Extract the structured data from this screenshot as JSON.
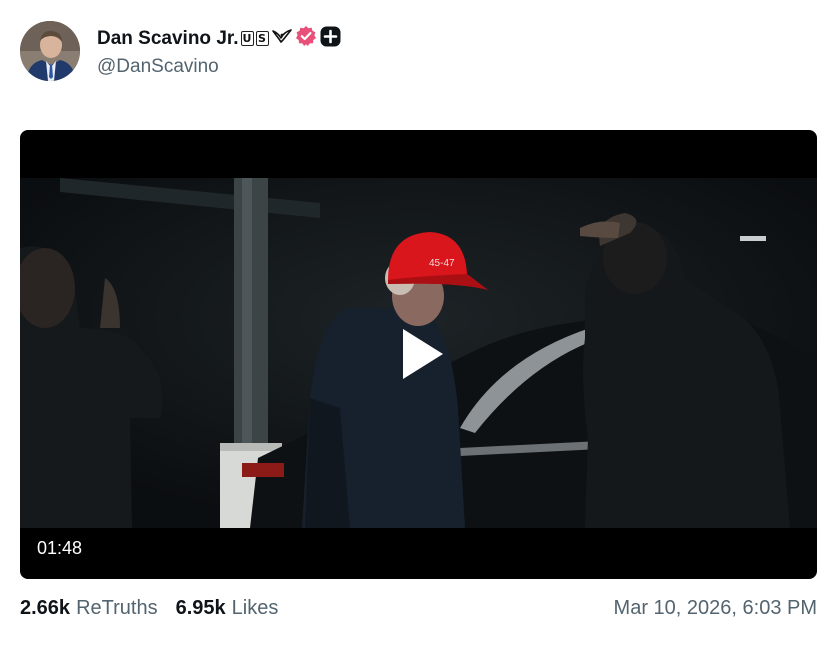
{
  "author": {
    "display_name": "Dan Scavino Jr.",
    "flag_letters": [
      "U",
      "S"
    ],
    "handle": "@DanScavino",
    "badges": [
      "eagle-icon",
      "verified-badge-icon",
      "plus-badge-icon"
    ]
  },
  "colors": {
    "verified": "#e8507a",
    "text_primary": "#0f1419",
    "text_secondary": "#53646f",
    "hat_red": "#d8161c"
  },
  "video": {
    "duration": "01:48",
    "hat_text": "45-47"
  },
  "stats": {
    "retruths_count": "2.66k",
    "retruths_label": "ReTruths",
    "likes_count": "6.95k",
    "likes_label": "Likes",
    "timestamp": "Mar 10, 2026, 6:03 PM"
  }
}
